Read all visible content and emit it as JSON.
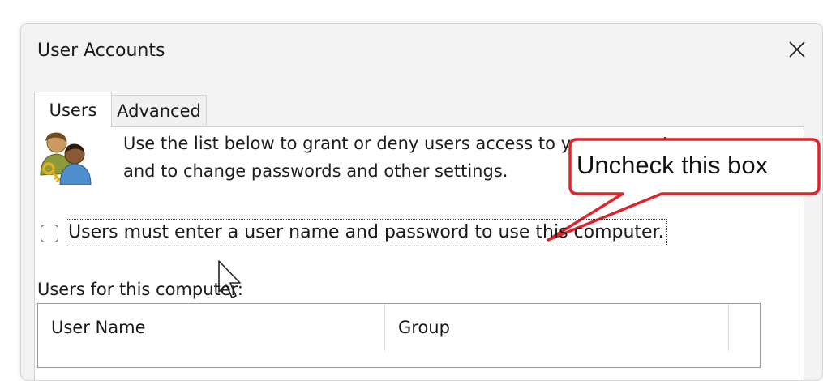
{
  "window": {
    "title": "User Accounts"
  },
  "tabs": [
    {
      "label": "Users",
      "active": true
    },
    {
      "label": "Advanced",
      "active": false
    }
  ],
  "description": {
    "line1": "Use the list below to grant or deny users access to your computer,",
    "line2": "and to change passwords and other settings."
  },
  "checkbox": {
    "label": "Users must enter a user name and password to use this computer.",
    "checked": false
  },
  "users_section": {
    "label": "Users for this computer:"
  },
  "table": {
    "columns": [
      "User Name",
      "Group"
    ]
  },
  "callout": {
    "text": "Uncheck this box",
    "color": "#e0242b"
  },
  "icons": [
    "close-icon",
    "users-icon",
    "mouse-cursor-icon"
  ]
}
